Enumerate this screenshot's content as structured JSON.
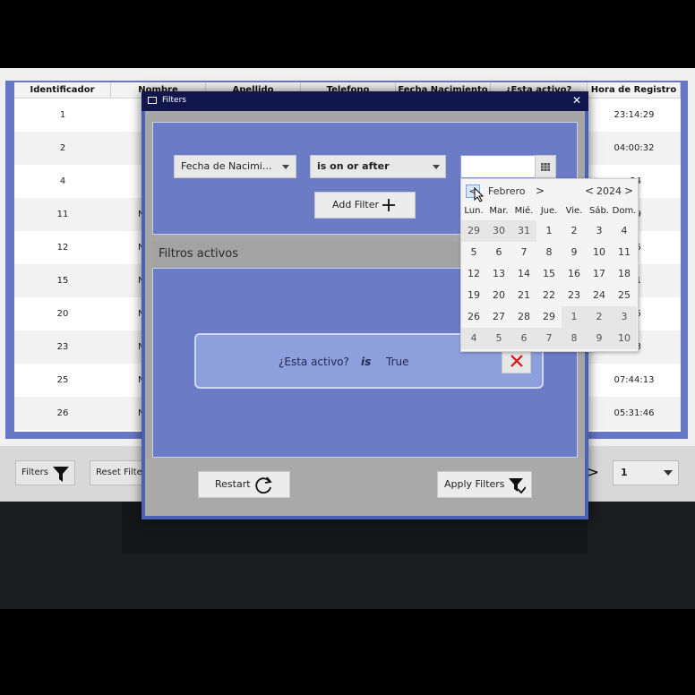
{
  "table": {
    "headers": [
      "Identificador",
      "Nombre",
      "Apellido",
      "Telefono",
      "Fecha Nacimiento",
      "¿Esta activo?",
      "Hora de Registro"
    ],
    "rows": [
      {
        "id": "1",
        "n": "",
        "h": "23:14:29"
      },
      {
        "id": "2",
        "n": "",
        "h": "04:00:32"
      },
      {
        "id": "4",
        "n": "",
        "h": ":34"
      },
      {
        "id": "11",
        "n": "N",
        "h": ":49"
      },
      {
        "id": "12",
        "n": "N",
        "h": ":15"
      },
      {
        "id": "15",
        "n": "N",
        "h": ":01"
      },
      {
        "id": "20",
        "n": "N",
        "h": ":15"
      },
      {
        "id": "23",
        "n": "N",
        "h": ":23"
      },
      {
        "id": "25",
        "n": "N",
        "h": "07:44:13"
      },
      {
        "id": "26",
        "n": "N",
        "h": "05:31:46"
      }
    ]
  },
  "bottom": {
    "filters_label": "Filters",
    "reset_label": "Reset Filte",
    "next_label": ">",
    "page_value": "1"
  },
  "dialog": {
    "title": "Filters",
    "column_select": "Fecha de Nacimi...",
    "operator_select": "is on or after",
    "date_value": "",
    "add_filter_label": "Add Filter",
    "active_header": "Filtros activos",
    "active_filter": {
      "field": "¿Esta activo?",
      "op": "is",
      "value": "True"
    },
    "restart_label": "Restart",
    "apply_label": "Apply Filters"
  },
  "calendar": {
    "month": "Febrero",
    "year": "2024",
    "prev": "<",
    "next": ">",
    "weekdays": [
      "Lun.",
      "Mar.",
      "Mié.",
      "Jue.",
      "Vie.",
      "Sáb.",
      "Dom."
    ],
    "days": [
      [
        "29",
        "30",
        "31",
        "1",
        "2",
        "3",
        "4"
      ],
      [
        "5",
        "6",
        "7",
        "8",
        "9",
        "10",
        "11"
      ],
      [
        "12",
        "13",
        "14",
        "15",
        "16",
        "17",
        "18"
      ],
      [
        "19",
        "20",
        "21",
        "22",
        "23",
        "24",
        "25"
      ],
      [
        "26",
        "27",
        "28",
        "29",
        "1",
        "2",
        "3"
      ],
      [
        "4",
        "5",
        "6",
        "7",
        "8",
        "9",
        "10"
      ]
    ]
  }
}
